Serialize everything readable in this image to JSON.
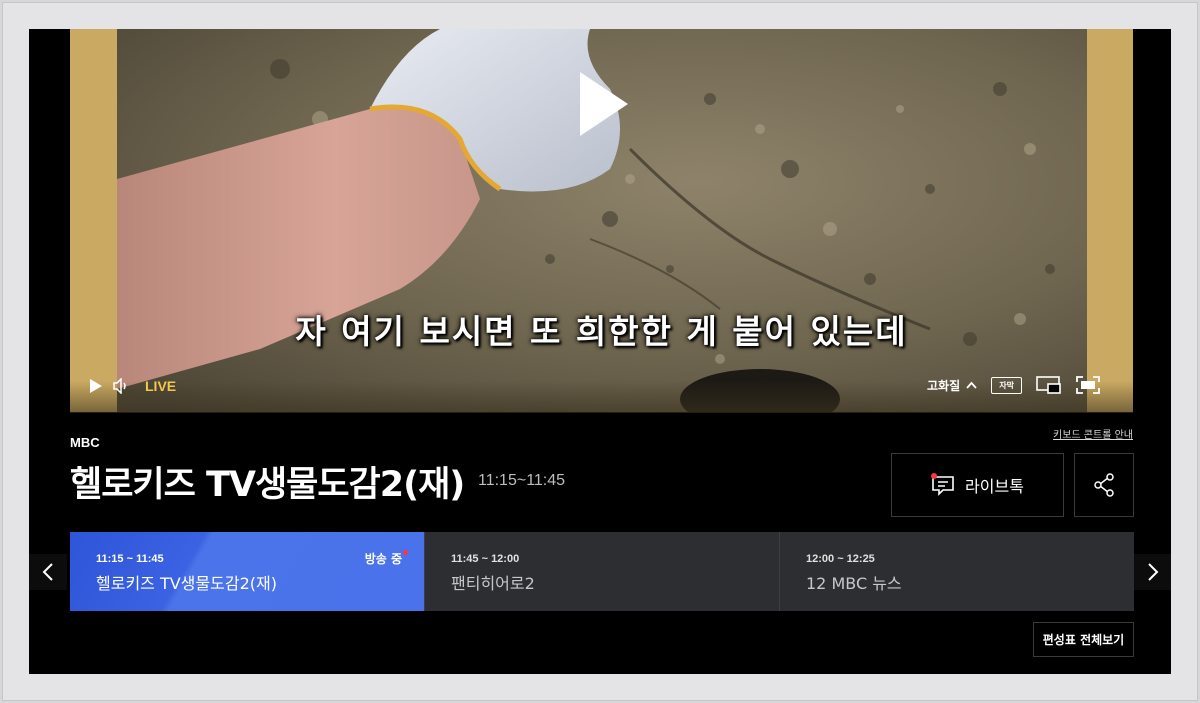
{
  "player": {
    "subtitle": "자 여기 보시면 또 희한한 게 붙어 있는데",
    "live_label": "LIVE",
    "quality_label": "고화질",
    "caption_button_label": "자막"
  },
  "channel": {
    "logo_text": "MBC",
    "keyboard_guide": "키보드 콘트롤 안내"
  },
  "program": {
    "title": "헬로키즈 TV생물도감2(재)",
    "time": "11:15~11:45"
  },
  "actions": {
    "livetalk_label": "라이브톡"
  },
  "schedule": {
    "items": [
      {
        "time": "11:15 ~ 11:45",
        "title": "헬로키즈 TV생물도감2(재)",
        "status": "방송 중"
      },
      {
        "time": "11:45 ~ 12:00",
        "title": "팬티히어로2"
      },
      {
        "time": "12:00 ~ 12:25",
        "title": "12 MBC 뉴스"
      }
    ],
    "full_schedule_label": "편성표 전체보기"
  },
  "colors": {
    "live": "#f2c94c",
    "active_schedule": "#3a62e2",
    "onair_dot": "#ff3344",
    "background": "#000000"
  },
  "icons": {
    "player": [
      "play-icon",
      "volume-icon",
      "chevron-up-icon",
      "caption-icon",
      "pip-icon",
      "fullscreen-icon"
    ],
    "actions": [
      "chat-icon",
      "share-icon"
    ],
    "nav": [
      "chevron-left-icon",
      "chevron-right-icon"
    ]
  }
}
